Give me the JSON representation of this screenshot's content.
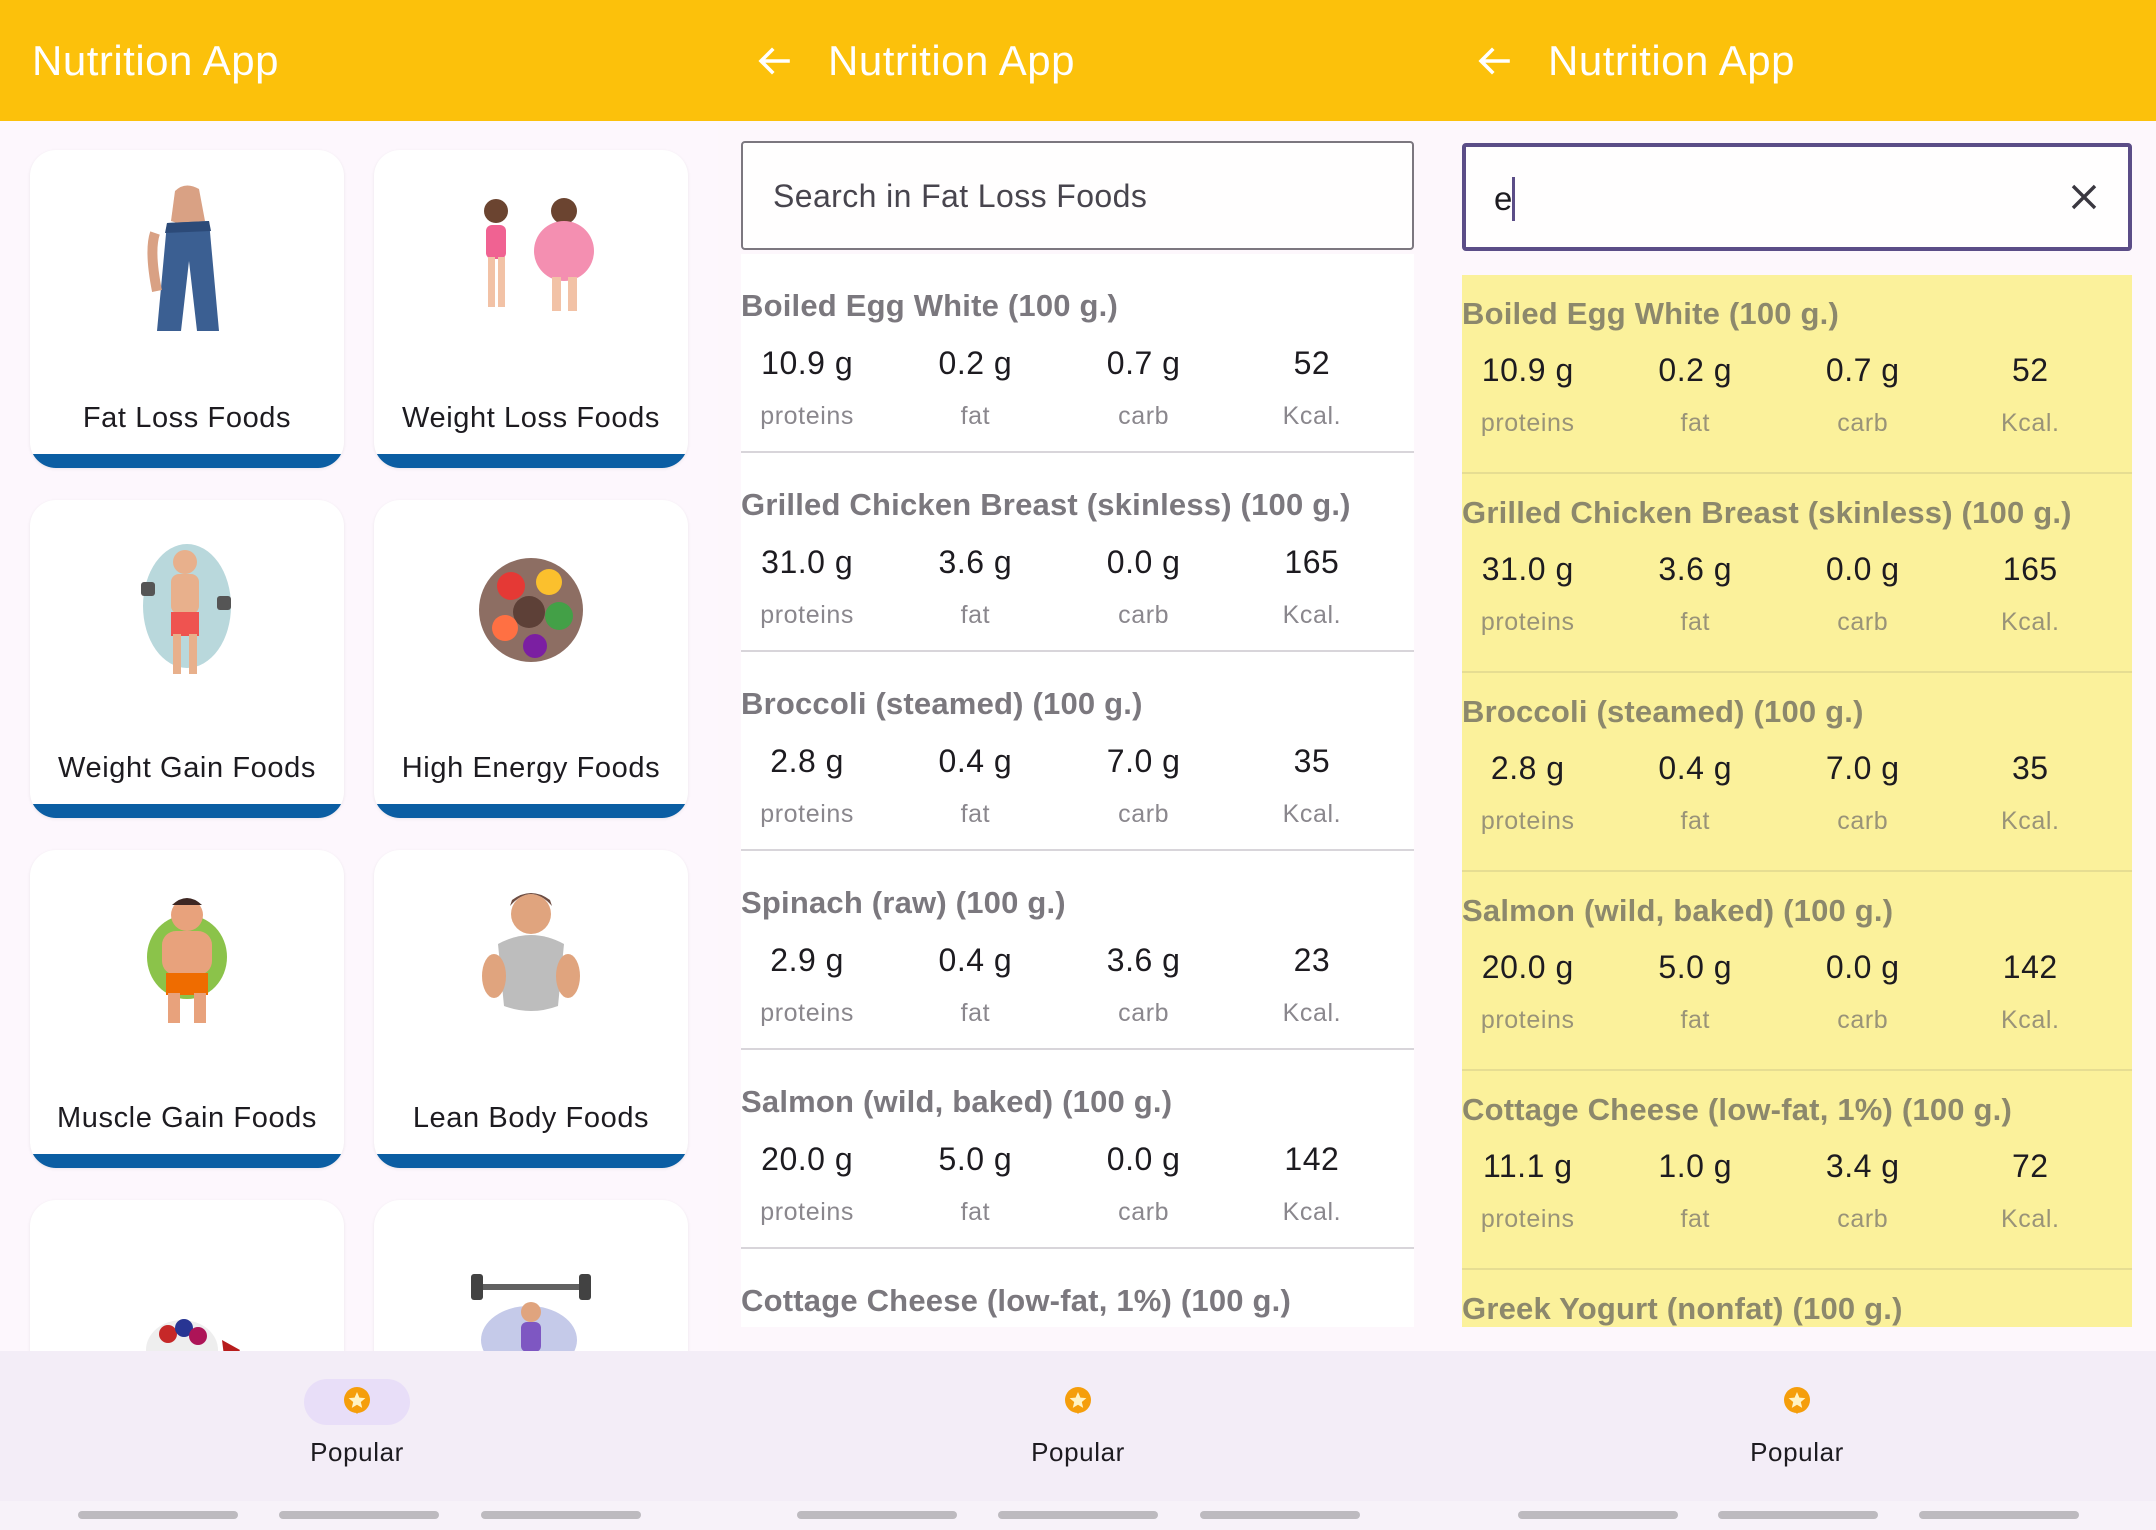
{
  "app": {
    "title": "Nutrition App"
  },
  "screen1": {
    "categories": [
      {
        "label": "Fat Loss Foods",
        "icon": "waist-measure-icon"
      },
      {
        "label": "Weight Loss Foods",
        "icon": "before-after-icon"
      },
      {
        "label": "Weight Gain Foods",
        "icon": "dumbbell-man-icon"
      },
      {
        "label": "High Energy Foods",
        "icon": "fruit-bowl-icon"
      },
      {
        "label": "Muscle Gain Foods",
        "icon": "muscle-man-icon"
      },
      {
        "label": "Lean Body Foods",
        "icon": "lean-man-icon"
      }
    ],
    "nav": {
      "label": "Popular",
      "icon": "star-badge-icon"
    }
  },
  "screen2": {
    "search": {
      "placeholder": "Search in Fat Loss Foods"
    },
    "units": {
      "proteins": "proteins",
      "fat": "fat",
      "carb": "carb",
      "kcal": "Kcal."
    },
    "foods": [
      {
        "name": "Boiled Egg White (100 g.)",
        "proteins": "10.9 g",
        "fat": "0.2 g",
        "carb": "0.7 g",
        "kcal": "52"
      },
      {
        "name": "Grilled Chicken Breast (skinless) (100 g.)",
        "proteins": "31.0 g",
        "fat": "3.6 g",
        "carb": "0.0 g",
        "kcal": "165"
      },
      {
        "name": "Broccoli (steamed) (100 g.)",
        "proteins": "2.8 g",
        "fat": "0.4 g",
        "carb": "7.0 g",
        "kcal": "35"
      },
      {
        "name": "Spinach (raw) (100 g.)",
        "proteins": "2.9 g",
        "fat": "0.4 g",
        "carb": "3.6 g",
        "kcal": "23"
      },
      {
        "name": "Salmon (wild, baked) (100 g.)",
        "proteins": "20.0 g",
        "fat": "5.0 g",
        "carb": "0.0 g",
        "kcal": "142"
      },
      {
        "name": "Cottage Cheese (low-fat, 1%) (100 g.)"
      }
    ],
    "nav": {
      "label": "Popular",
      "icon": "star-badge-icon"
    }
  },
  "screen3": {
    "search": {
      "value": "e"
    },
    "units": {
      "proteins": "proteins",
      "fat": "fat",
      "carb": "carb",
      "kcal": "Kcal."
    },
    "foods": [
      {
        "name": "Boiled Egg White (100 g.)",
        "proteins": "10.9 g",
        "fat": "0.2 g",
        "carb": "0.7 g",
        "kcal": "52"
      },
      {
        "name": "Grilled Chicken Breast (skinless) (100 g.)",
        "proteins": "31.0 g",
        "fat": "3.6 g",
        "carb": "0.0 g",
        "kcal": "165"
      },
      {
        "name": "Broccoli (steamed) (100 g.)",
        "proteins": "2.8 g",
        "fat": "0.4 g",
        "carb": "7.0 g",
        "kcal": "35"
      },
      {
        "name": "Salmon (wild, baked) (100 g.)",
        "proteins": "20.0 g",
        "fat": "5.0 g",
        "carb": "0.0 g",
        "kcal": "142"
      },
      {
        "name": "Cottage Cheese (low-fat, 1%) (100 g.)",
        "proteins": "11.1 g",
        "fat": "1.0 g",
        "carb": "3.4 g",
        "kcal": "72"
      },
      {
        "name": "Greek Yogurt (nonfat) (100 g.)"
      }
    ],
    "nav": {
      "label": "Popular",
      "icon": "star-badge-icon"
    }
  },
  "colors": {
    "appbar": "#fcc10b",
    "card_bar": "#0b5ea3",
    "highlight": "#fbf19b",
    "focus_border": "#5b4d87",
    "nav_bg": "#f3edf7"
  }
}
